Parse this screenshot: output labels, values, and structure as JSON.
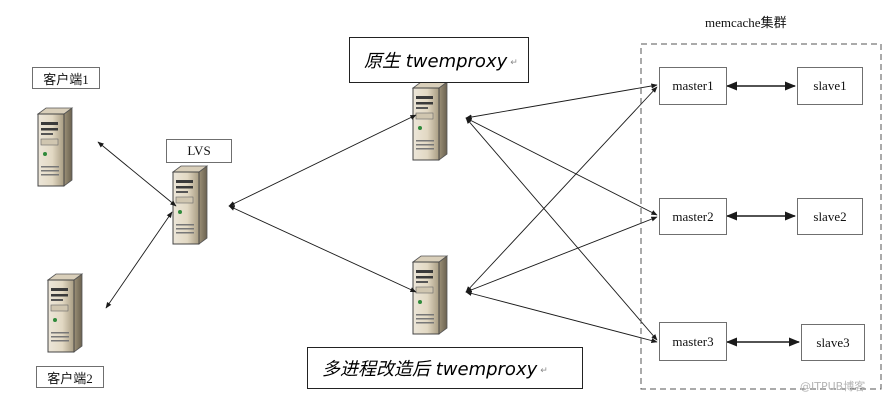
{
  "cluster_title": "memcache集群",
  "clients": [
    {
      "label": "客户端1"
    },
    {
      "label": "客户端2"
    }
  ],
  "lvs": {
    "label": "LVS"
  },
  "proxy_original": {
    "label": "原生 twemproxy"
  },
  "proxy_multiprocess": {
    "label": "多进程改造后 twemproxy"
  },
  "masters": [
    "master1",
    "master2",
    "master3"
  ],
  "slaves": [
    "slave1",
    "slave2",
    "slave3"
  ],
  "watermark": "@ITPUB博客"
}
